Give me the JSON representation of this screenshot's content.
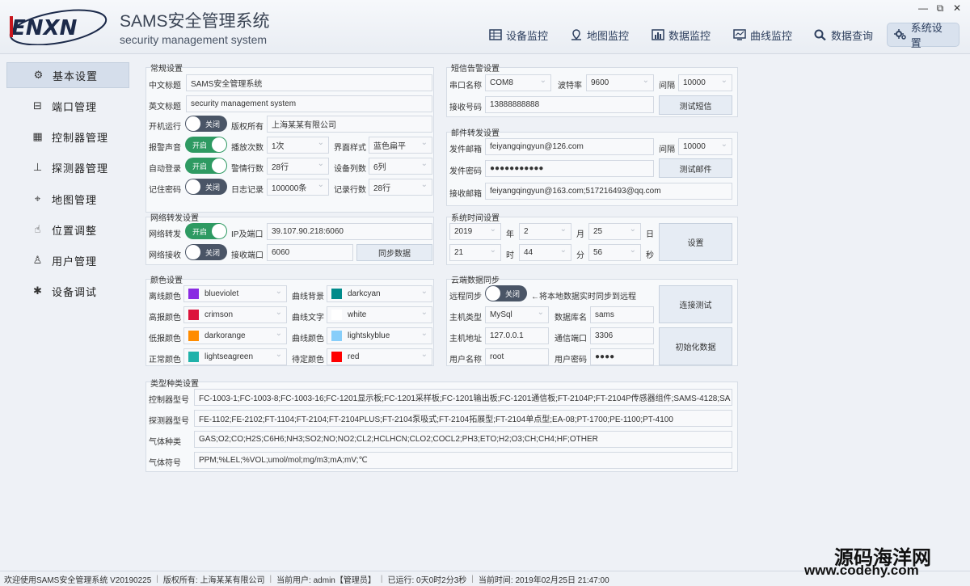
{
  "window": {
    "title": "SAMS安全管理系统",
    "subtitle": "security management system",
    "logo_text": "ENXN",
    "controls": [
      "—",
      "⧉",
      "✕"
    ]
  },
  "nav": [
    {
      "label": "设备监控",
      "icon": "monitor-icon"
    },
    {
      "label": "地图监控",
      "icon": "map-pin-icon"
    },
    {
      "label": "数据监控",
      "icon": "chart-icon"
    },
    {
      "label": "曲线监控",
      "icon": "curve-icon"
    },
    {
      "label": "数据查询",
      "icon": "search-icon"
    },
    {
      "label": "系统设置",
      "icon": "gear-icon"
    }
  ],
  "sidebar": [
    {
      "label": "基本设置",
      "icon": "gear-icon"
    },
    {
      "label": "端口管理",
      "icon": "port-icon"
    },
    {
      "label": "控制器管理",
      "icon": "controller-icon"
    },
    {
      "label": "探测器管理",
      "icon": "sitemap-icon"
    },
    {
      "label": "地图管理",
      "icon": "map-pin-icon"
    },
    {
      "label": "位置调整",
      "icon": "hand-icon"
    },
    {
      "label": "用户管理",
      "icon": "user-icon"
    },
    {
      "label": "设备调试",
      "icon": "bug-icon"
    }
  ],
  "general": {
    "title": "常规设置",
    "cn_title_label": "中文标题",
    "cn_title": "SAMS安全管理系统",
    "en_title_label": "英文标题",
    "en_title": "security management system",
    "autorun_label": "开机运行",
    "autorun": "关闭",
    "copyright_label": "版权所有",
    "copyright": "上海某某有限公司",
    "alarm_sound_label": "报警声音",
    "alarm_sound": "开启",
    "play_count_label": "播放次数",
    "play_count": "1次",
    "ui_style_label": "界面样式",
    "ui_style": "蓝色扁平",
    "autologin_label": "自动登录",
    "autologin": "开启",
    "alarm_rows_label": "警情行数",
    "alarm_rows": "28行",
    "device_cols_label": "设备列数",
    "device_cols": "6列",
    "remember_label": "记住密码",
    "remember": "关闭",
    "log_label": "日志记录",
    "log": "100000条",
    "record_rows_label": "记录行数",
    "record_rows": "28行"
  },
  "network": {
    "title": "网络转发设置",
    "forward_label": "网络转发",
    "forward": "开启",
    "ip_port_label": "IP及端口",
    "ip_port": "39.107.90.218:6060",
    "receive_label": "网络接收",
    "receive": "关闭",
    "recv_port_label": "接收端口",
    "recv_port": "6060",
    "sync_button": "同步数据"
  },
  "color": {
    "title": "颜色设置",
    "offline_label": "离线颜色",
    "offline": "blueviolet",
    "offline_hex": "#8a2be2",
    "curve_bg_label": "曲线背景",
    "curve_bg": "darkcyan",
    "curve_bg_hex": "#008b8b",
    "high_label": "高报颜色",
    "high": "crimson",
    "high_hex": "#dc143c",
    "curve_text_label": "曲线文字",
    "curve_text": "white",
    "curve_text_hex": "#ffffff",
    "low_label": "低报颜色",
    "low": "darkorange",
    "low_hex": "#ff8c00",
    "curve_color_label": "曲线颜色",
    "curve_color": "lightskyblue",
    "curve_color_hex": "#87cefa",
    "normal_label": "正常颜色",
    "normal": "lightseagreen",
    "normal_hex": "#20b2aa",
    "pending_label": "待定颜色",
    "pending": "red",
    "pending_hex": "#ff0000"
  },
  "sms": {
    "title": "短信告警设置",
    "port_label": "串口名称",
    "port": "COM8",
    "baud_label": "波特率",
    "baud": "9600",
    "interval_label": "间隔",
    "interval": "10000",
    "number_label": "接收号码",
    "number": "13888888888",
    "test_button": "测试短信"
  },
  "mail": {
    "title": "邮件转发设置",
    "sender_label": "发件邮箱",
    "sender": "feiyangqingyun@126.com",
    "interval_label": "间隔",
    "interval": "10000",
    "password_label": "发件密码",
    "password": "●●●●●●●●●●●",
    "test_button": "测试邮件",
    "receiver_label": "接收邮箱",
    "receiver": "feiyangqingyun@163.com;517216493@qq.com"
  },
  "time": {
    "title": "系统时间设置",
    "year": "2019",
    "year_unit": "年",
    "month": "2",
    "month_unit": "月",
    "day": "25",
    "day_unit": "日",
    "hour": "21",
    "hour_unit": "时",
    "minute": "44",
    "minute_unit": "分",
    "second": "56",
    "second_unit": "秒",
    "set_button": "设置"
  },
  "cloud": {
    "title": "云端数据同步",
    "remote_label": "远程同步",
    "remote": "关闭",
    "remote_hint": "←将本地数据实时同步到远程",
    "host_type_label": "主机类型",
    "host_type": "MySql",
    "db_label": "数据库名",
    "db": "sams",
    "host_addr_label": "主机地址",
    "host_addr": "127.0.0.1",
    "comm_port_label": "通信端口",
    "comm_port": "3306",
    "user_label": "用户名称",
    "user": "root",
    "pwd_label": "用户密码",
    "pwd": "●●●●",
    "connect_button": "连接测试",
    "init_button": "初始化数据"
  },
  "types": {
    "title": "类型种类设置",
    "controller_label": "控制器型号",
    "controller": "FC-1003-1;FC-1003-8;FC-1003-16;FC-1201显示板;FC-1201采样板;FC-1201输出板;FC-1201通信板;FT-2104P;FT-2104P传感器组件;SAMS-4128;SA",
    "detector_label": "探测器型号",
    "detector": "FE-1102;FE-2102;FT-1104;FT-2104;FT-2104PLUS;FT-2104泵吸式;FT-2104拓展型;FT-2104单点型;EA-08;PT-1700;PE-1100;PT-4100",
    "gas_label": "气体种类",
    "gas": "GAS;O2;CO;H2S;C6H6;NH3;SO2;NO;NO2;CL2;HCLHCN;CLO2;COCL2;PH3;ETO;H2;O3;CH;CH4;HF;OTHER",
    "symbol_label": "气体符号",
    "symbol": "PPM;%LEL;%VOL;umol/mol;mg/m3;mA;mV;℃"
  },
  "status": {
    "welcome": "欢迎使用SAMS安全管理系统 V20190225",
    "copyright": "版权所有: 上海某某有限公司",
    "user": "当前用户: admin【管理员】",
    "running": "已运行: 0天0时2分3秒",
    "time": "当前时间: 2019年02月25日 21:47:00"
  },
  "watermark": {
    "line1": "源码海洋网",
    "line2": "www.codehy.com"
  }
}
